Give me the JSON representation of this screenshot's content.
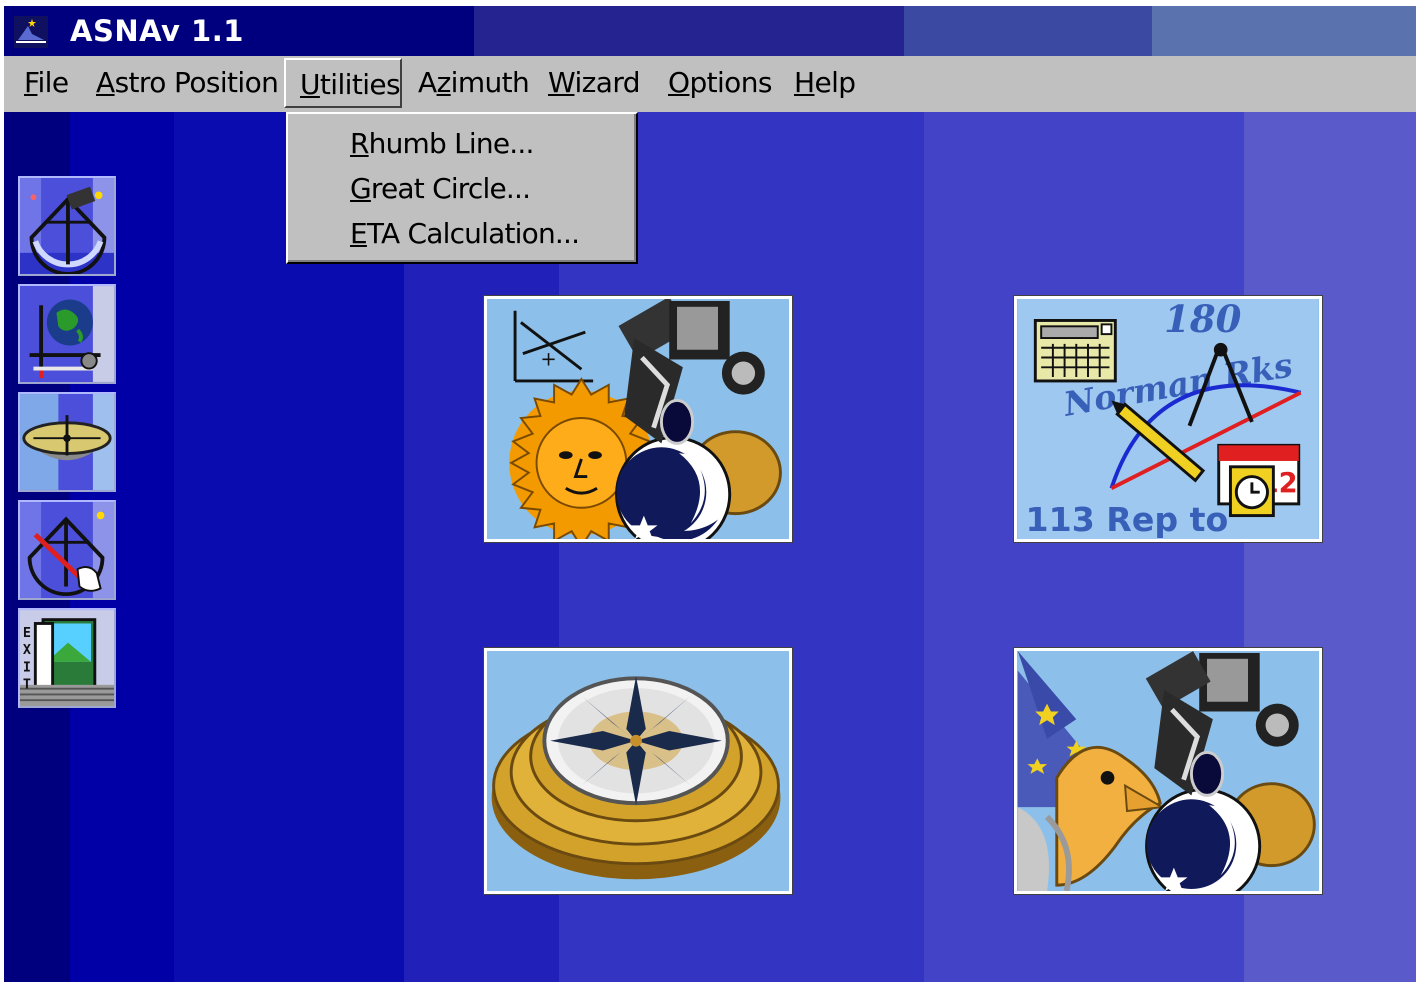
{
  "window": {
    "title": "ASNAv 1.1"
  },
  "menubar": {
    "items": [
      {
        "first": "F",
        "rest": "ile"
      },
      {
        "first": "A",
        "rest": "stro Position"
      },
      {
        "first": "U",
        "rest": "tilities"
      },
      {
        "pre": "A",
        "first": "z",
        "rest": "imuth"
      },
      {
        "first": "W",
        "rest": "izard"
      },
      {
        "first": "O",
        "rest": "ptions"
      },
      {
        "first": "H",
        "rest": "elp"
      }
    ]
  },
  "dropdown": {
    "items": [
      {
        "first": "R",
        "rest": "humb Line..."
      },
      {
        "first": "G",
        "rest": "reat Circle..."
      },
      {
        "first": "E",
        "rest": "TA Calculation..."
      }
    ]
  },
  "toolbar": {
    "buttons": [
      "sextant-icon",
      "globe-instruments-icon",
      "compass-dish-icon",
      "sextant-pointer-icon",
      "exit-door-icon"
    ],
    "exit_label": "EXIT"
  },
  "tiles": {
    "chart_texts": [
      "180",
      "Norman Rks",
      "113 Rep to"
    ],
    "calendar_label": "12"
  },
  "colors": {
    "title_bar": "#00007e",
    "menu_bg": "#c0c0c0",
    "client_bg": "#3434c2",
    "tile_sky": "#8cc0ea"
  }
}
